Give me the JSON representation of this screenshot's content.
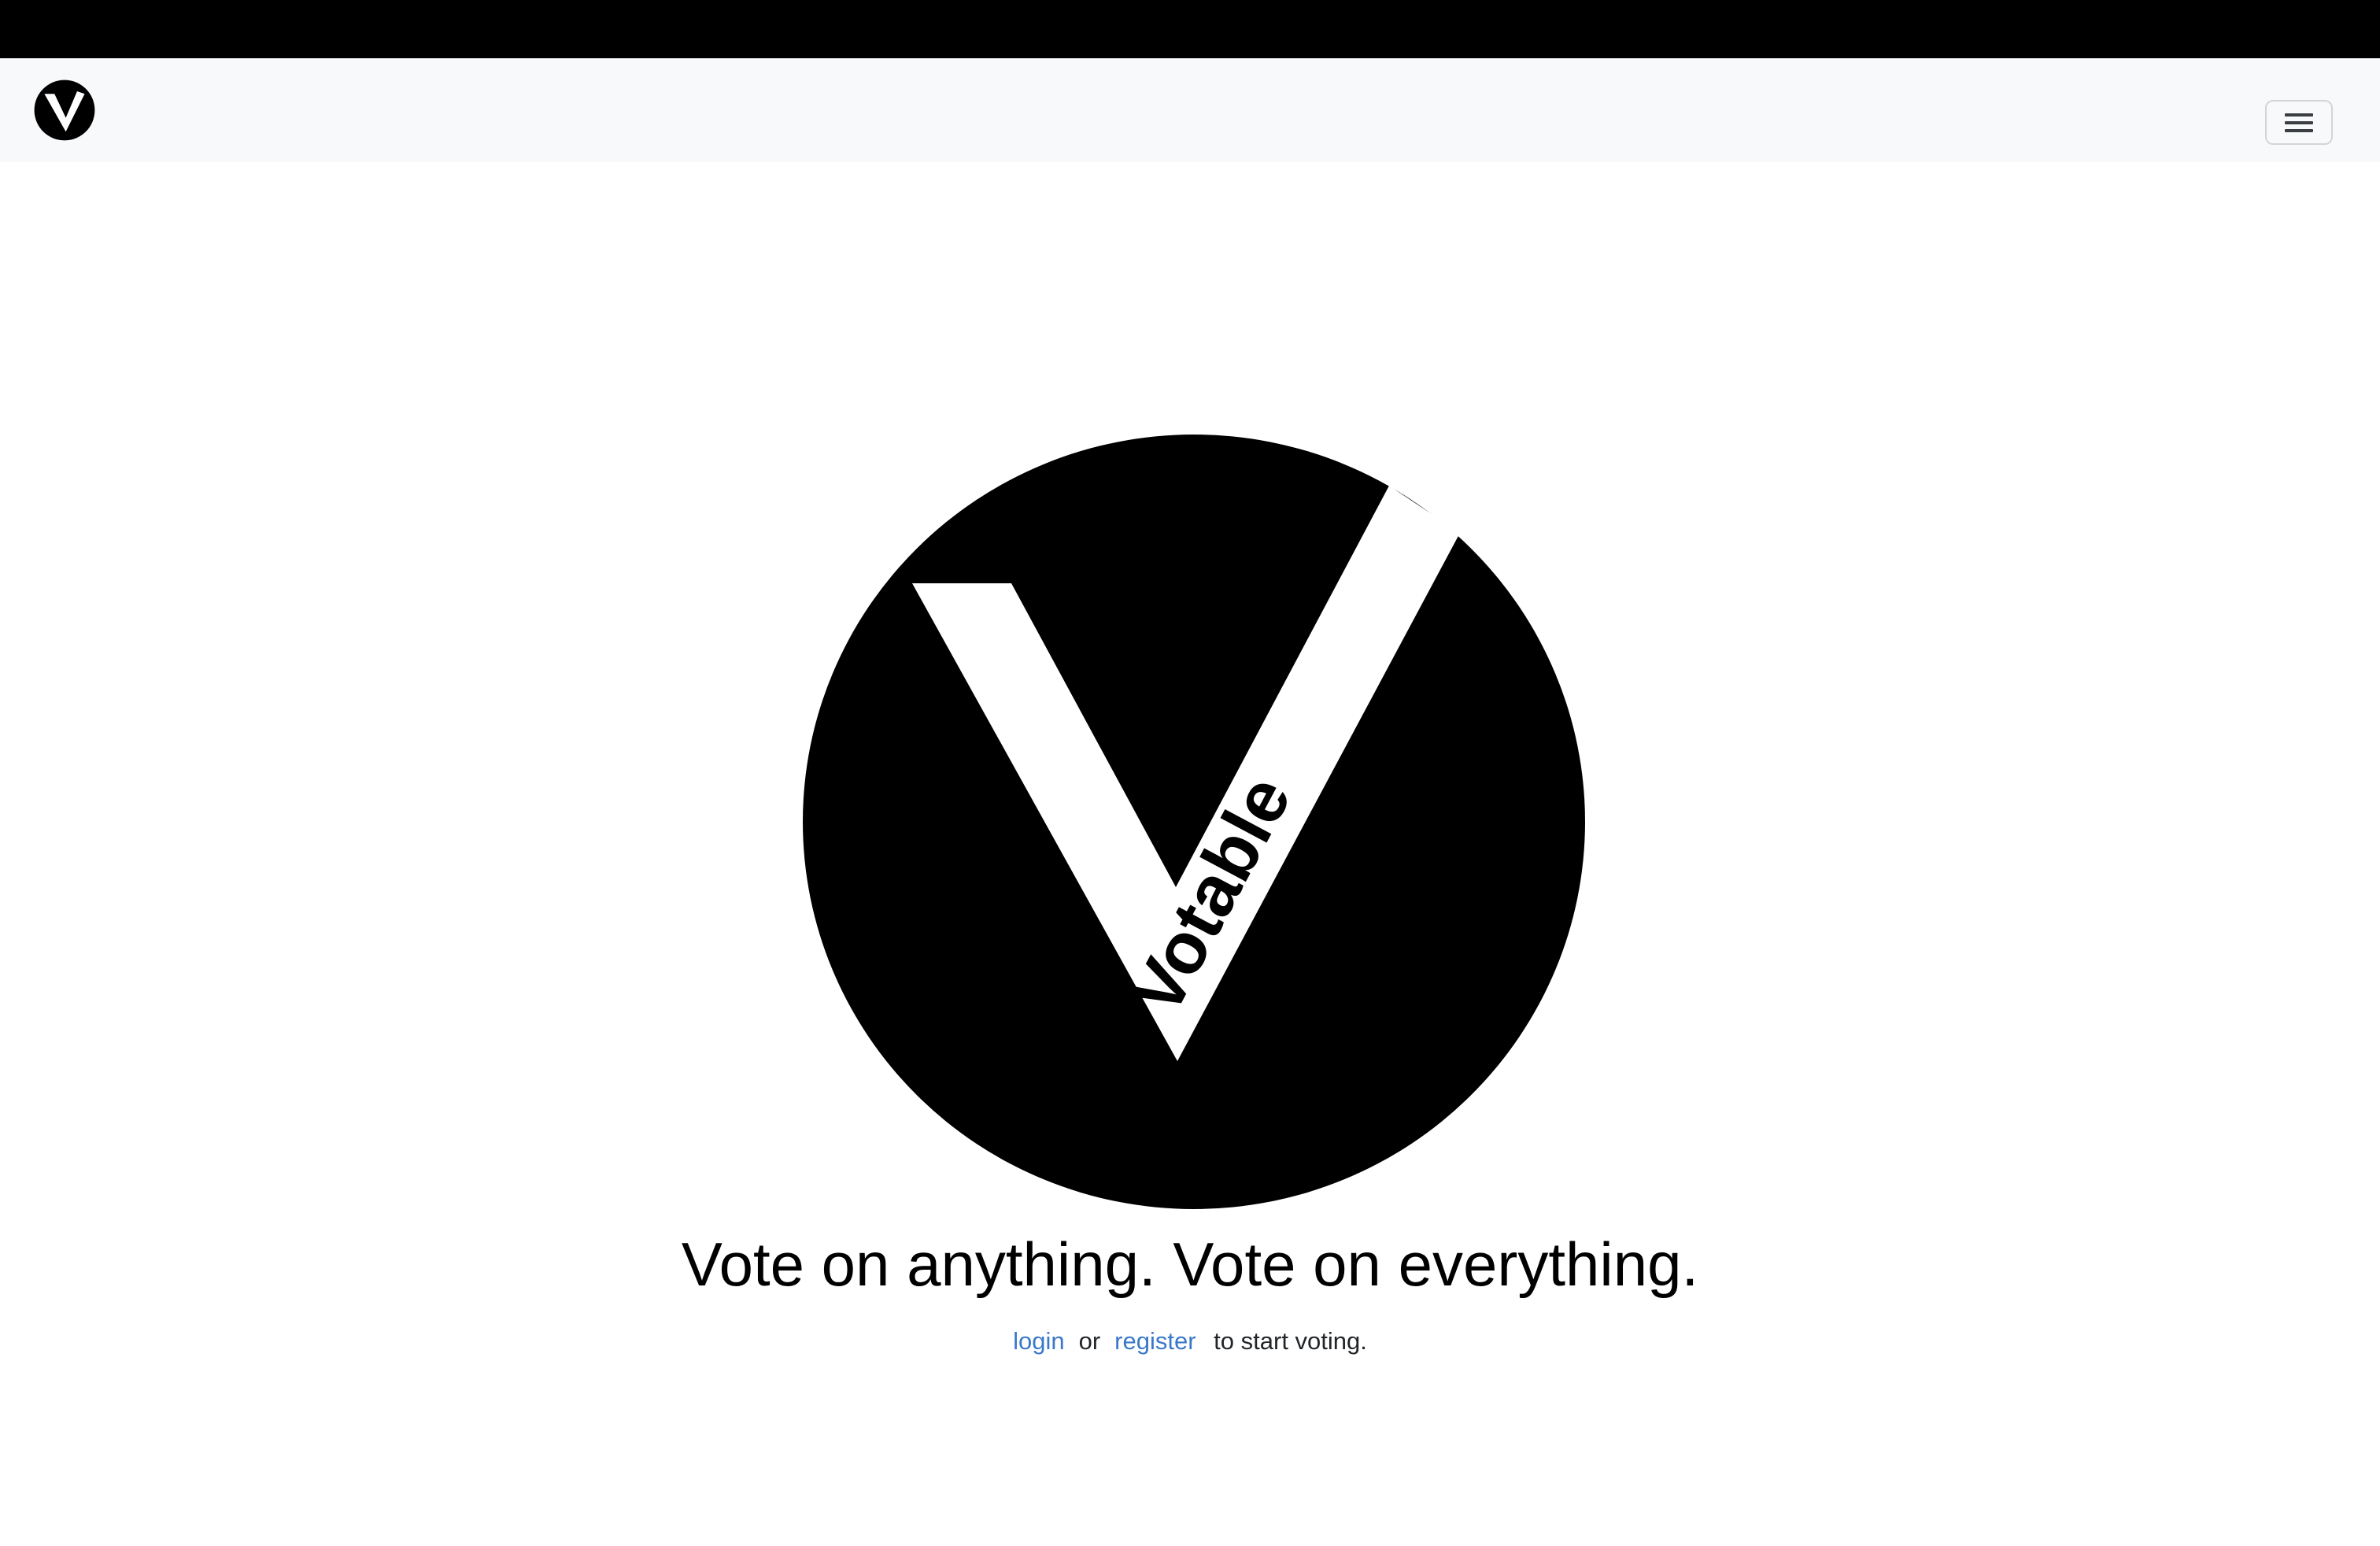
{
  "brand": {
    "name": "Votable",
    "logo_icon": "votable-v-logo"
  },
  "navbar": {
    "toggler_icon": "hamburger-menu-icon"
  },
  "hero": {
    "logo_text": "Votable",
    "headline": "Vote on anything. Vote on everything.",
    "login_label": "login",
    "or_text": "or",
    "register_label": "register",
    "suffix_text": "to start voting."
  },
  "colors": {
    "link": "#3a78c9",
    "text": "#212529",
    "navbar_bg": "#f8f9fa",
    "topbar_bg": "#000000"
  }
}
